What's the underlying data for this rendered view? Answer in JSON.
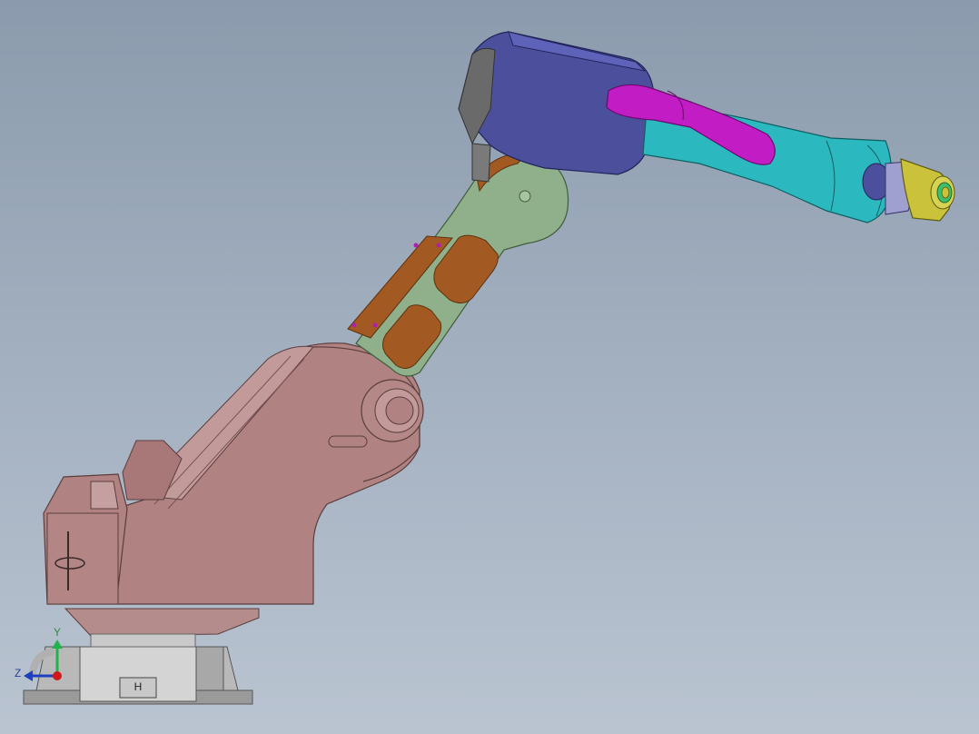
{
  "viewport": {
    "background_top": "#8b9bad",
    "background_bottom": "#bac4d1"
  },
  "model": {
    "base_plate_label": "H",
    "colors": {
      "base": "#b9b9b9",
      "turret": "#b08282",
      "lower_arm": "#8fb08a",
      "lower_arm_pads": "#a35a22",
      "wrist_housing": "#4b4f9c",
      "forearm": "#2bb9bf",
      "cable": "#c21cc4",
      "tool_flange": "#c9c23a"
    }
  },
  "triad": {
    "y_label": "Y",
    "z_label": "Z",
    "y_color": "#22b14c",
    "z_color": "#1f3fbf",
    "x_color": "#d01818"
  }
}
